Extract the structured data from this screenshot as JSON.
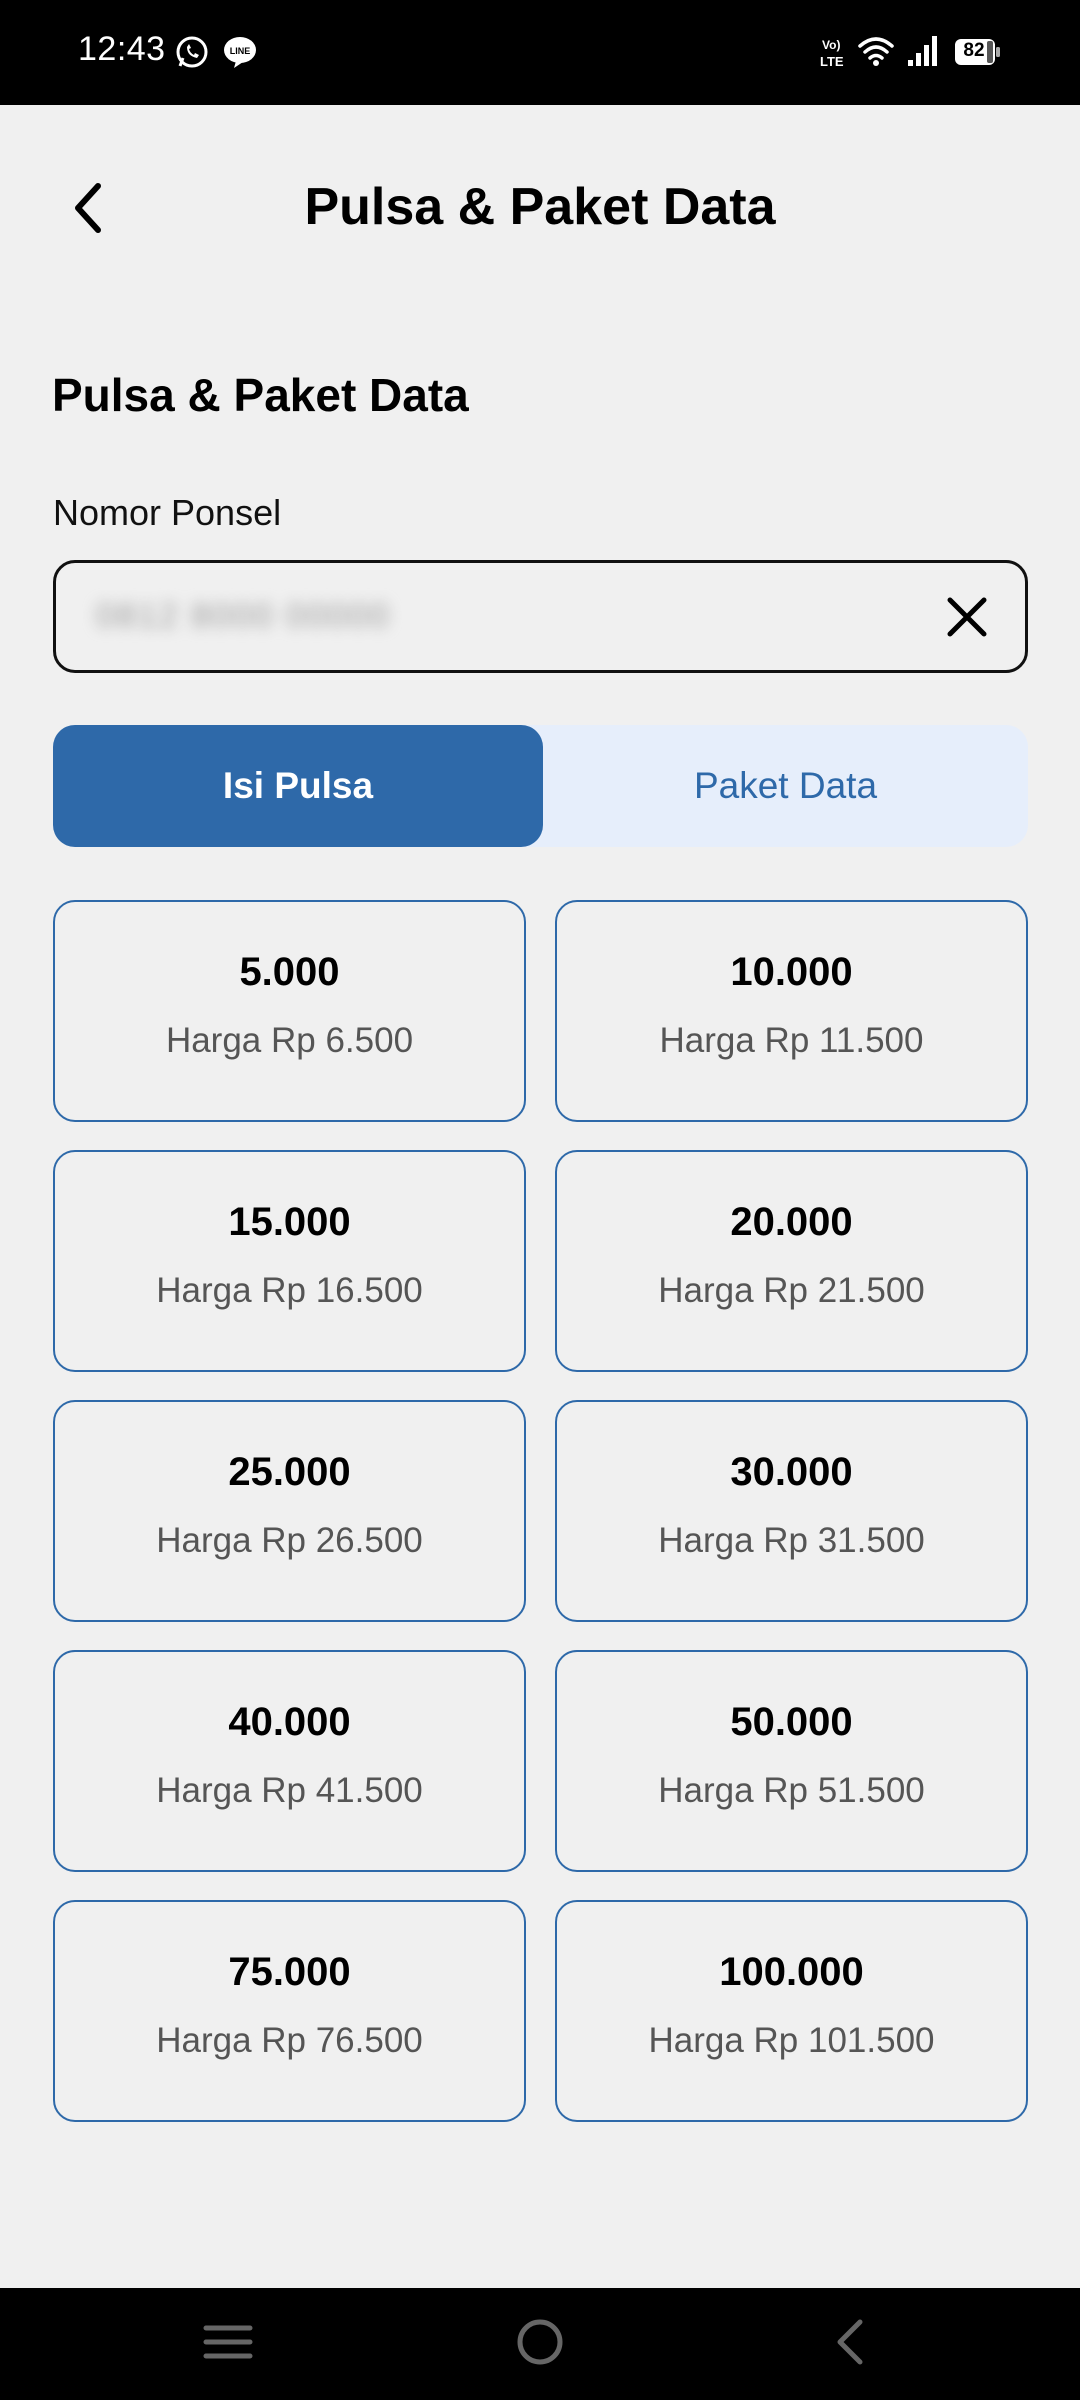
{
  "status_bar": {
    "time": "12:43",
    "left_icons": [
      "whatsapp-icon",
      "line-icon"
    ],
    "right_icons": [
      "volte-icon",
      "wifi-icon",
      "signal-icon",
      "battery-icon"
    ],
    "battery_level": "82"
  },
  "header": {
    "title": "Pulsa & Paket Data",
    "back_icon": "chevron-left-icon"
  },
  "section_title": "Pulsa & Paket Data",
  "phone": {
    "label": "Nomor Ponsel",
    "value": "0812 8000 00000",
    "clear_icon": "close-icon"
  },
  "tabs": [
    {
      "label": "Isi Pulsa",
      "active": true
    },
    {
      "label": "Paket Data",
      "active": false
    }
  ],
  "denominations": [
    {
      "amount": "5.000",
      "price": "Harga Rp 6.500"
    },
    {
      "amount": "10.000",
      "price": "Harga Rp 11.500"
    },
    {
      "amount": "15.000",
      "price": "Harga Rp 16.500"
    },
    {
      "amount": "20.000",
      "price": "Harga Rp 21.500"
    },
    {
      "amount": "25.000",
      "price": "Harga Rp 26.500"
    },
    {
      "amount": "30.000",
      "price": "Harga Rp 31.500"
    },
    {
      "amount": "40.000",
      "price": "Harga Rp 41.500"
    },
    {
      "amount": "50.000",
      "price": "Harga Rp 51.500"
    },
    {
      "amount": "75.000",
      "price": "Harga Rp 76.500"
    },
    {
      "amount": "100.000",
      "price": "Harga Rp 101.500"
    }
  ],
  "nav_bar": {
    "icons": [
      "menu-icon",
      "home-icon",
      "back-icon"
    ]
  },
  "colors": {
    "primary": "#2e69a9",
    "tab_background": "#e6eefb",
    "page_background": "#f0f0f0",
    "price_text": "#555555"
  }
}
